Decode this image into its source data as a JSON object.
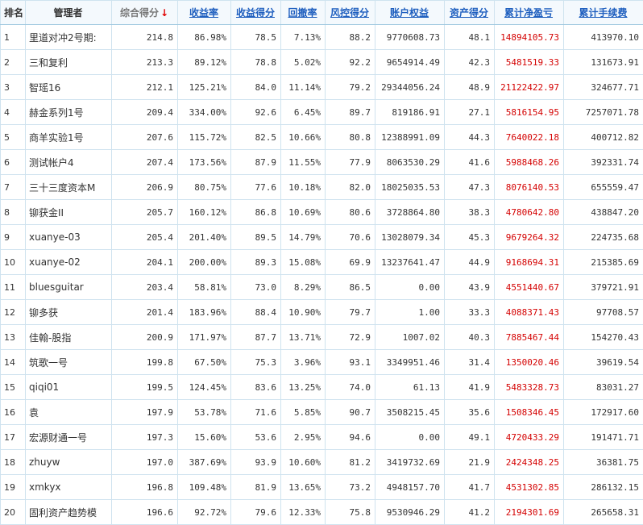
{
  "colors": {
    "header_link": "#1f5fbf",
    "profit_red": "#d40000",
    "border": "#cfe3ef",
    "header_bg": "#f4f9fd",
    "sort_arrow": "#e00000"
  },
  "header": {
    "rank": "排名",
    "manager": "管理者",
    "composite": "综合得分",
    "sort_icon": "↓",
    "return_rate": "收益率",
    "return_score": "收益得分",
    "drawdown": "回撤率",
    "risk_score": "风控得分",
    "equity": "账户权益",
    "asset_score": "资产得分",
    "net_profit": "累计净盈亏",
    "fees": "累计手续费"
  },
  "rows": [
    {
      "rank": "1",
      "name": "里道对冲2号期:",
      "score": "214.8",
      "ret": "86.98%",
      "ret_s": "78.5",
      "dd": "7.13%",
      "risk": "88.2",
      "equity": "9770608.73",
      "asset": "48.1",
      "profit": "14894105.73",
      "fee": "413970.10"
    },
    {
      "rank": "2",
      "name": "三和复利",
      "score": "213.3",
      "ret": "89.12%",
      "ret_s": "78.8",
      "dd": "5.02%",
      "risk": "92.2",
      "equity": "9654914.49",
      "asset": "42.3",
      "profit": "5481519.33",
      "fee": "131673.91"
    },
    {
      "rank": "3",
      "name": "智瑶16",
      "score": "212.1",
      "ret": "125.21%",
      "ret_s": "84.0",
      "dd": "11.14%",
      "risk": "79.2",
      "equity": "29344056.24",
      "asset": "48.9",
      "profit": "21122422.97",
      "fee": "324677.71"
    },
    {
      "rank": "4",
      "name": "赫金系列1号",
      "score": "209.4",
      "ret": "334.00%",
      "ret_s": "92.6",
      "dd": "6.45%",
      "risk": "89.7",
      "equity": "819186.91",
      "asset": "27.1",
      "profit": "5816154.95",
      "fee": "7257071.78"
    },
    {
      "rank": "5",
      "name": "商羊实验1号",
      "score": "207.6",
      "ret": "115.72%",
      "ret_s": "82.5",
      "dd": "10.66%",
      "risk": "80.8",
      "equity": "12388991.09",
      "asset": "44.3",
      "profit": "7640022.18",
      "fee": "400712.82"
    },
    {
      "rank": "6",
      "name": "测试帐户4",
      "score": "207.4",
      "ret": "173.56%",
      "ret_s": "87.9",
      "dd": "11.55%",
      "risk": "77.9",
      "equity": "8063530.29",
      "asset": "41.6",
      "profit": "5988468.26",
      "fee": "392331.74"
    },
    {
      "rank": "7",
      "name": "三十三度资本M",
      "score": "206.9",
      "ret": "80.75%",
      "ret_s": "77.6",
      "dd": "10.18%",
      "risk": "82.0",
      "equity": "18025035.53",
      "asset": "47.3",
      "profit": "8076140.53",
      "fee": "655559.47"
    },
    {
      "rank": "8",
      "name": "铆获金II",
      "score": "205.7",
      "ret": "160.12%",
      "ret_s": "86.8",
      "dd": "10.69%",
      "risk": "80.6",
      "equity": "3728864.80",
      "asset": "38.3",
      "profit": "4780642.80",
      "fee": "438847.20"
    },
    {
      "rank": "9",
      "name": "xuanye-03",
      "score": "205.4",
      "ret": "201.40%",
      "ret_s": "89.5",
      "dd": "14.79%",
      "risk": "70.6",
      "equity": "13028079.34",
      "asset": "45.3",
      "profit": "9679264.32",
      "fee": "224735.68"
    },
    {
      "rank": "10",
      "name": "xuanye-02",
      "score": "204.1",
      "ret": "200.00%",
      "ret_s": "89.3",
      "dd": "15.08%",
      "risk": "69.9",
      "equity": "13237641.47",
      "asset": "44.9",
      "profit": "9168694.31",
      "fee": "215385.69"
    },
    {
      "rank": "11",
      "name": "bluesguitar",
      "score": "203.4",
      "ret": "58.81%",
      "ret_s": "73.0",
      "dd": "8.29%",
      "risk": "86.5",
      "equity": "0.00",
      "asset": "43.9",
      "profit": "4551440.67",
      "fee": "379721.91"
    },
    {
      "rank": "12",
      "name": "铆多获",
      "score": "201.4",
      "ret": "183.96%",
      "ret_s": "88.4",
      "dd": "10.90%",
      "risk": "79.7",
      "equity": "1.00",
      "asset": "33.3",
      "profit": "4088371.43",
      "fee": "97708.57"
    },
    {
      "rank": "13",
      "name": "佳翰-股指",
      "score": "200.9",
      "ret": "171.97%",
      "ret_s": "87.7",
      "dd": "13.71%",
      "risk": "72.9",
      "equity": "1007.02",
      "asset": "40.3",
      "profit": "7885467.44",
      "fee": "154270.43"
    },
    {
      "rank": "14",
      "name": "筑歌一号",
      "score": "199.8",
      "ret": "67.50%",
      "ret_s": "75.3",
      "dd": "3.96%",
      "risk": "93.1",
      "equity": "3349951.46",
      "asset": "31.4",
      "profit": "1350020.46",
      "fee": "39619.54"
    },
    {
      "rank": "15",
      "name": "qiqi01",
      "score": "199.5",
      "ret": "124.45%",
      "ret_s": "83.6",
      "dd": "13.25%",
      "risk": "74.0",
      "equity": "61.13",
      "asset": "41.9",
      "profit": "5483328.73",
      "fee": "83031.27"
    },
    {
      "rank": "16",
      "name": "袁",
      "score": "197.9",
      "ret": "53.78%",
      "ret_s": "71.6",
      "dd": "5.85%",
      "risk": "90.7",
      "equity": "3508215.45",
      "asset": "35.6",
      "profit": "1508346.45",
      "fee": "172917.60"
    },
    {
      "rank": "17",
      "name": "宏源财通一号",
      "score": "197.3",
      "ret": "15.60%",
      "ret_s": "53.6",
      "dd": "2.95%",
      "risk": "94.6",
      "equity": "0.00",
      "asset": "49.1",
      "profit": "4720433.29",
      "fee": "191471.71"
    },
    {
      "rank": "18",
      "name": "zhuyw",
      "score": "197.0",
      "ret": "387.69%",
      "ret_s": "93.9",
      "dd": "10.60%",
      "risk": "81.2",
      "equity": "3419732.69",
      "asset": "21.9",
      "profit": "2424348.25",
      "fee": "36381.75"
    },
    {
      "rank": "19",
      "name": "xmkyx",
      "score": "196.8",
      "ret": "109.48%",
      "ret_s": "81.9",
      "dd": "13.65%",
      "risk": "73.2",
      "equity": "4948157.70",
      "asset": "41.7",
      "profit": "4531302.85",
      "fee": "286132.15"
    },
    {
      "rank": "20",
      "name": "固利资产趋势模",
      "score": "196.6",
      "ret": "92.72%",
      "ret_s": "79.6",
      "dd": "12.33%",
      "risk": "75.8",
      "equity": "9530946.29",
      "asset": "41.2",
      "profit": "2194301.69",
      "fee": "265658.31"
    }
  ]
}
